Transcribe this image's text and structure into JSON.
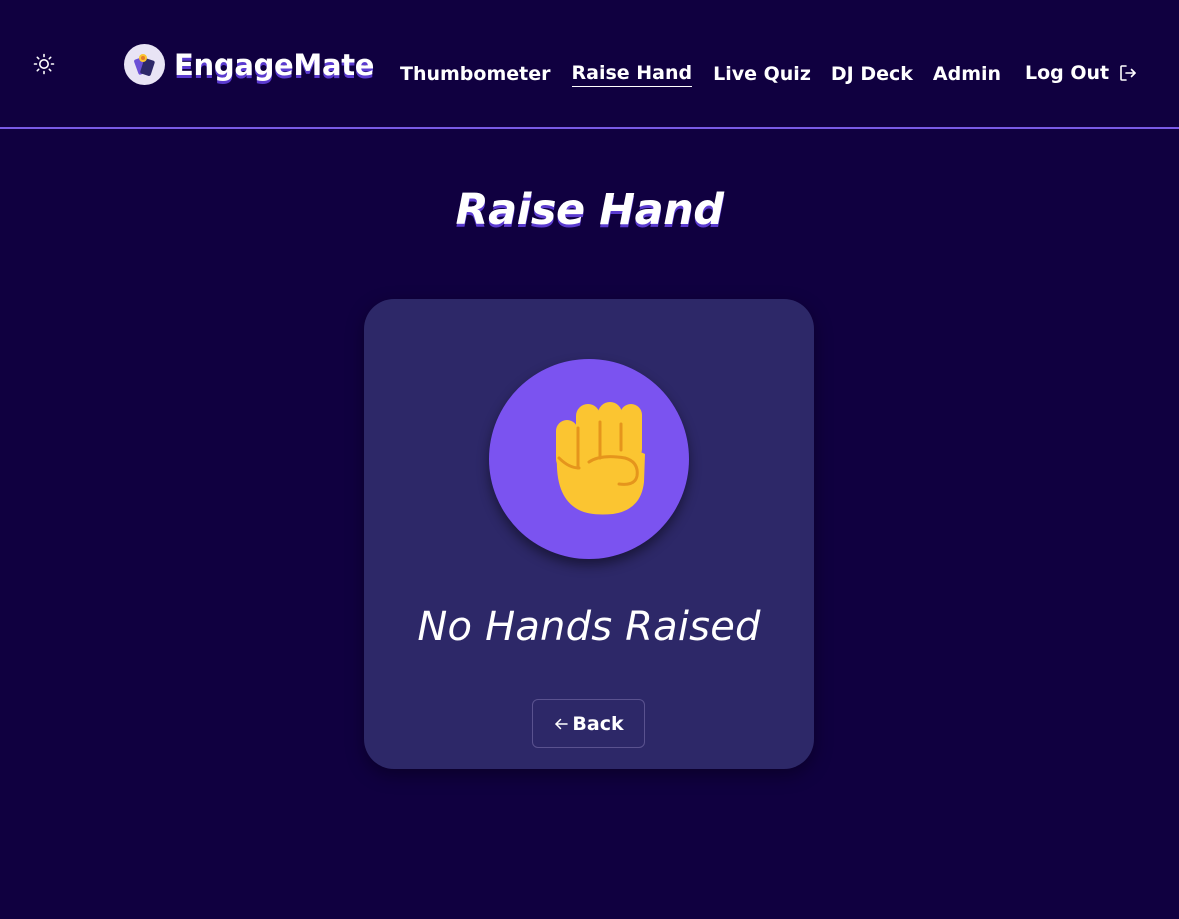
{
  "header": {
    "theme_toggle_icon": "sun-icon",
    "brand": {
      "name": "EngageMate",
      "logo_icon": "engagemate-logo-icon"
    },
    "nav": [
      {
        "label": "Thumbometer",
        "active": false
      },
      {
        "label": "Raise Hand",
        "active": true
      },
      {
        "label": "Live Quiz",
        "active": false
      },
      {
        "label": "DJ Deck",
        "active": false
      },
      {
        "label": "Admin",
        "active": false
      }
    ],
    "logout": {
      "label": "Log Out",
      "icon": "logout-icon"
    }
  },
  "main": {
    "title": "Raise Hand",
    "card": {
      "icon": "raised-fist-icon",
      "status": "No Hands Raised",
      "back_button": {
        "label": "Back",
        "icon": "arrow-left-icon"
      }
    }
  },
  "colors": {
    "background": "#100040",
    "card": "#2d2868",
    "accent": "#7b53f0",
    "divider": "#7a5ae6",
    "fist": "#fbc531"
  }
}
